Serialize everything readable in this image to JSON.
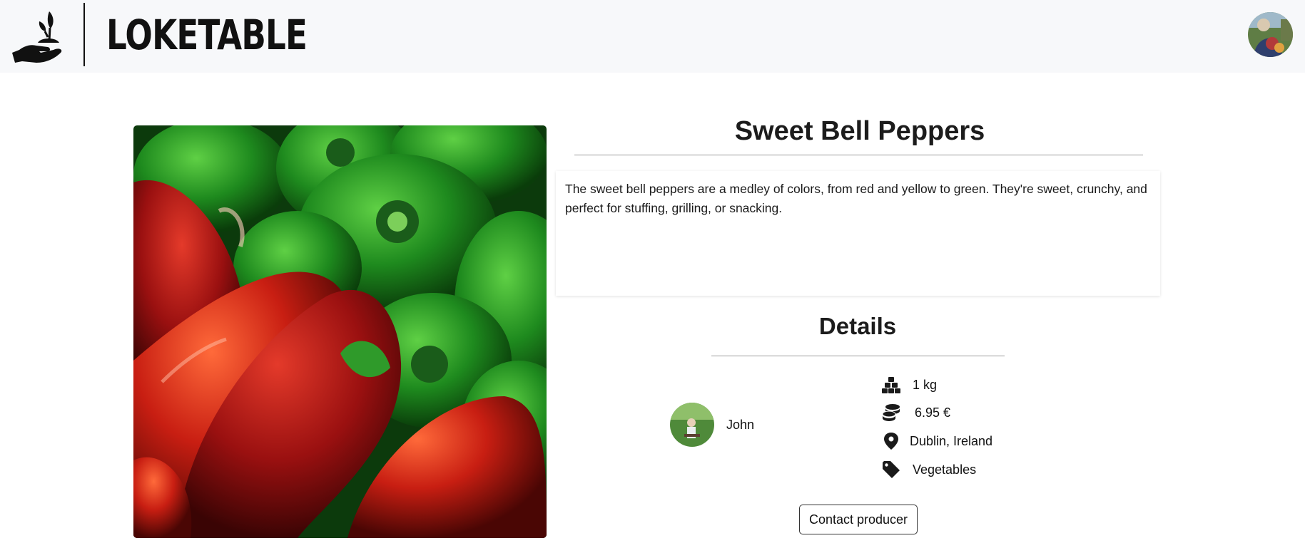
{
  "header": {
    "brand": "LOKETABLE",
    "logo_icon": "hand-plant-icon",
    "avatar_icon": "user-avatar"
  },
  "product": {
    "title": "Sweet Bell Peppers",
    "description": "The sweet bell peppers are a medley of colors, from red and yellow to green. They're sweet, crunchy, and perfect for stuffing, grilling, or snacking.",
    "image_icon": "bell-peppers-photo"
  },
  "details": {
    "heading": "Details",
    "producer_name": "John",
    "quantity": "1 kg",
    "price": "6.95 €",
    "location": "Dublin, Ireland",
    "category": "Vegetables",
    "icons": [
      "boxes-icon",
      "coins-icon",
      "location-pin-icon",
      "tag-icon"
    ]
  },
  "actions": {
    "contact_label": "Contact producer"
  },
  "colors": {
    "header_bg": "#f7f8fa",
    "text": "#1a1a1a",
    "rule": "#9a9a9a"
  }
}
